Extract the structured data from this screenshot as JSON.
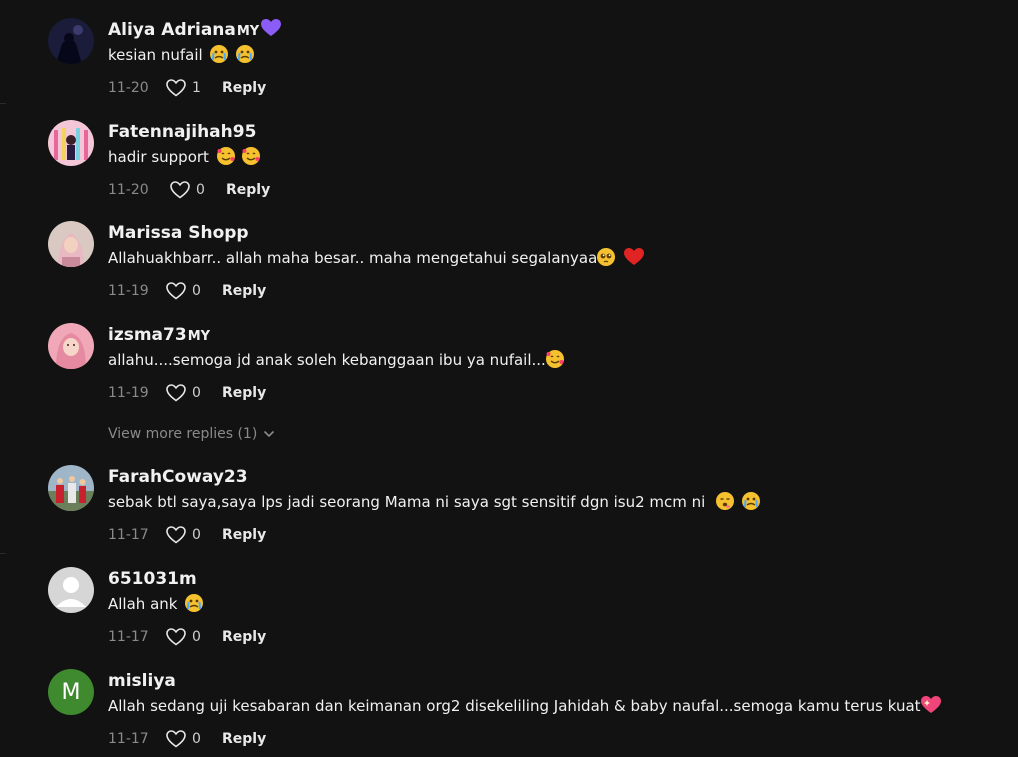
{
  "comments": [
    {
      "username": "Aliya Adriana",
      "badge": "MY",
      "badge_heart": true,
      "text": "kesian nufail",
      "emojis": [
        "crying-face",
        "crying-face"
      ],
      "date": "11-20",
      "likes": "1",
      "reply_label": "Reply",
      "avatar": "silhouette-dark"
    },
    {
      "username": "Fatennajihah95",
      "badge": "",
      "text": "hadir support",
      "emojis": [
        "smiling-hearts-face",
        "smiling-hearts-face"
      ],
      "date": "11-20",
      "likes": "0",
      "reply_label": "Reply",
      "avatar": "pink-gate"
    },
    {
      "username": "Marissa Shopp",
      "badge": "",
      "text": "Allahuakhbarr.. allah maha besar.. maha mengetahui segalanyaa",
      "emojis": [
        "pleading-face",
        "red-heart"
      ],
      "date": "11-19",
      "likes": "0",
      "reply_label": "Reply",
      "avatar": "hijab-woman"
    },
    {
      "username": "izsma73",
      "badge": "MY",
      "text": "allahu....semoga jd anak soleh kebanggaan ibu ya nufail...",
      "emojis": [
        "smiling-hearts-face"
      ],
      "date": "11-19",
      "likes": "0",
      "reply_label": "Reply",
      "avatar": "pink-portrait"
    },
    {
      "username": "FarahCoway23",
      "badge": "",
      "text": "sebak btl saya,saya lps jadi seorang Mama ni saya sgt sensitif dgn isu2 mcm ni",
      "emojis": [
        "hot-face",
        "crying-face"
      ],
      "date": "11-17",
      "likes": "0",
      "reply_label": "Reply",
      "avatar": "outdoor-group"
    },
    {
      "username": "651031m",
      "badge": "",
      "text": "Allah ank",
      "emojis": [
        "crying-face"
      ],
      "date": "11-17",
      "likes": "0",
      "reply_label": "Reply",
      "avatar": "default-user"
    },
    {
      "username": "misliya",
      "badge": "",
      "text": "Allah sedang uji kesabaran dan keimanan org2 disekeliling Jahidah & baby naufal...semoga kamu terus kuat",
      "emojis": [
        "sparkling-heart"
      ],
      "date": "11-17",
      "likes": "0",
      "reply_label": "Reply",
      "avatar": "letter-M",
      "avatar_letter": "M"
    }
  ],
  "view_more": {
    "label": "View more replies (1)"
  },
  "colors": {
    "background": "#121212",
    "text": "#f1f1f1",
    "muted": "#8a8a8a",
    "badge_heart": "#8b5cf6",
    "avatar_m": "#3f8a2e"
  }
}
